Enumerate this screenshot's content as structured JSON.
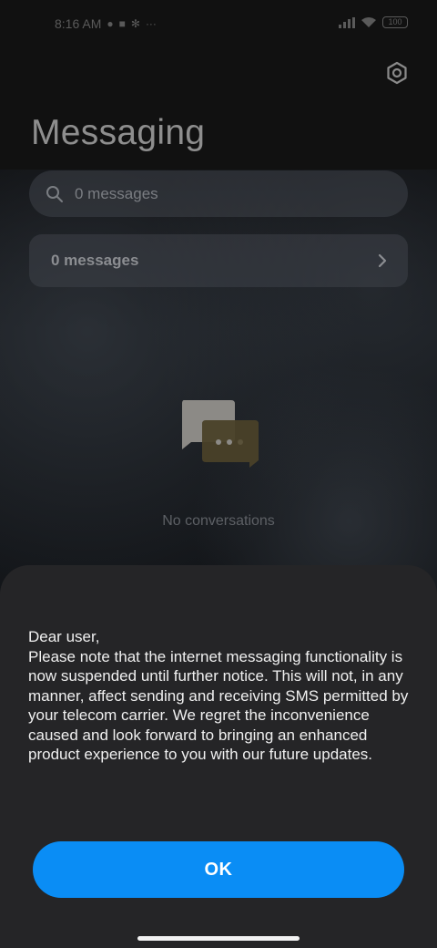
{
  "status_bar": {
    "time": "8:16 AM",
    "battery": "100"
  },
  "header": {
    "title": "Messaging"
  },
  "search": {
    "placeholder": "0 messages"
  },
  "messages_row": {
    "label": "0 messages"
  },
  "empty_state": {
    "text": "No conversations"
  },
  "dialog": {
    "message": "Dear user,\nPlease note that the internet messaging functionality is now suspended until further notice. This will not, in any manner, affect sending and receiving SMS permitted by your telecom carrier. We regret the inconvenience caused and look forward to bringing an enhanced product experience to you with our future updates.",
    "ok_label": "OK"
  },
  "colors": {
    "accent": "#0a8df5",
    "dialog_bg": "#252527"
  },
  "icons": [
    "signal-icon",
    "wifi-icon",
    "battery-icon",
    "settings-gear-icon",
    "search-icon",
    "chevron-right-icon",
    "chat-bubbles-icon"
  ]
}
